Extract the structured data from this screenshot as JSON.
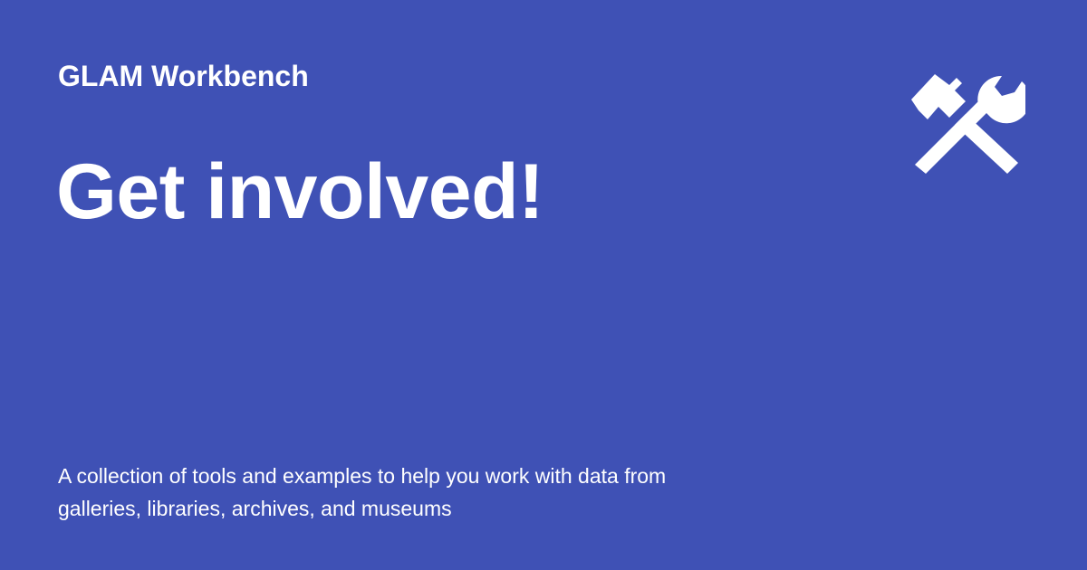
{
  "site": {
    "name": "GLAM Workbench",
    "logo_icon": "hammer-and-wrench-icon"
  },
  "page": {
    "title": "Get involved!",
    "description": "A collection of tools and examples to help you work with data from galleries, libraries, archives, and museums"
  },
  "colors": {
    "background": "#3f51b5",
    "text": "#ffffff"
  }
}
